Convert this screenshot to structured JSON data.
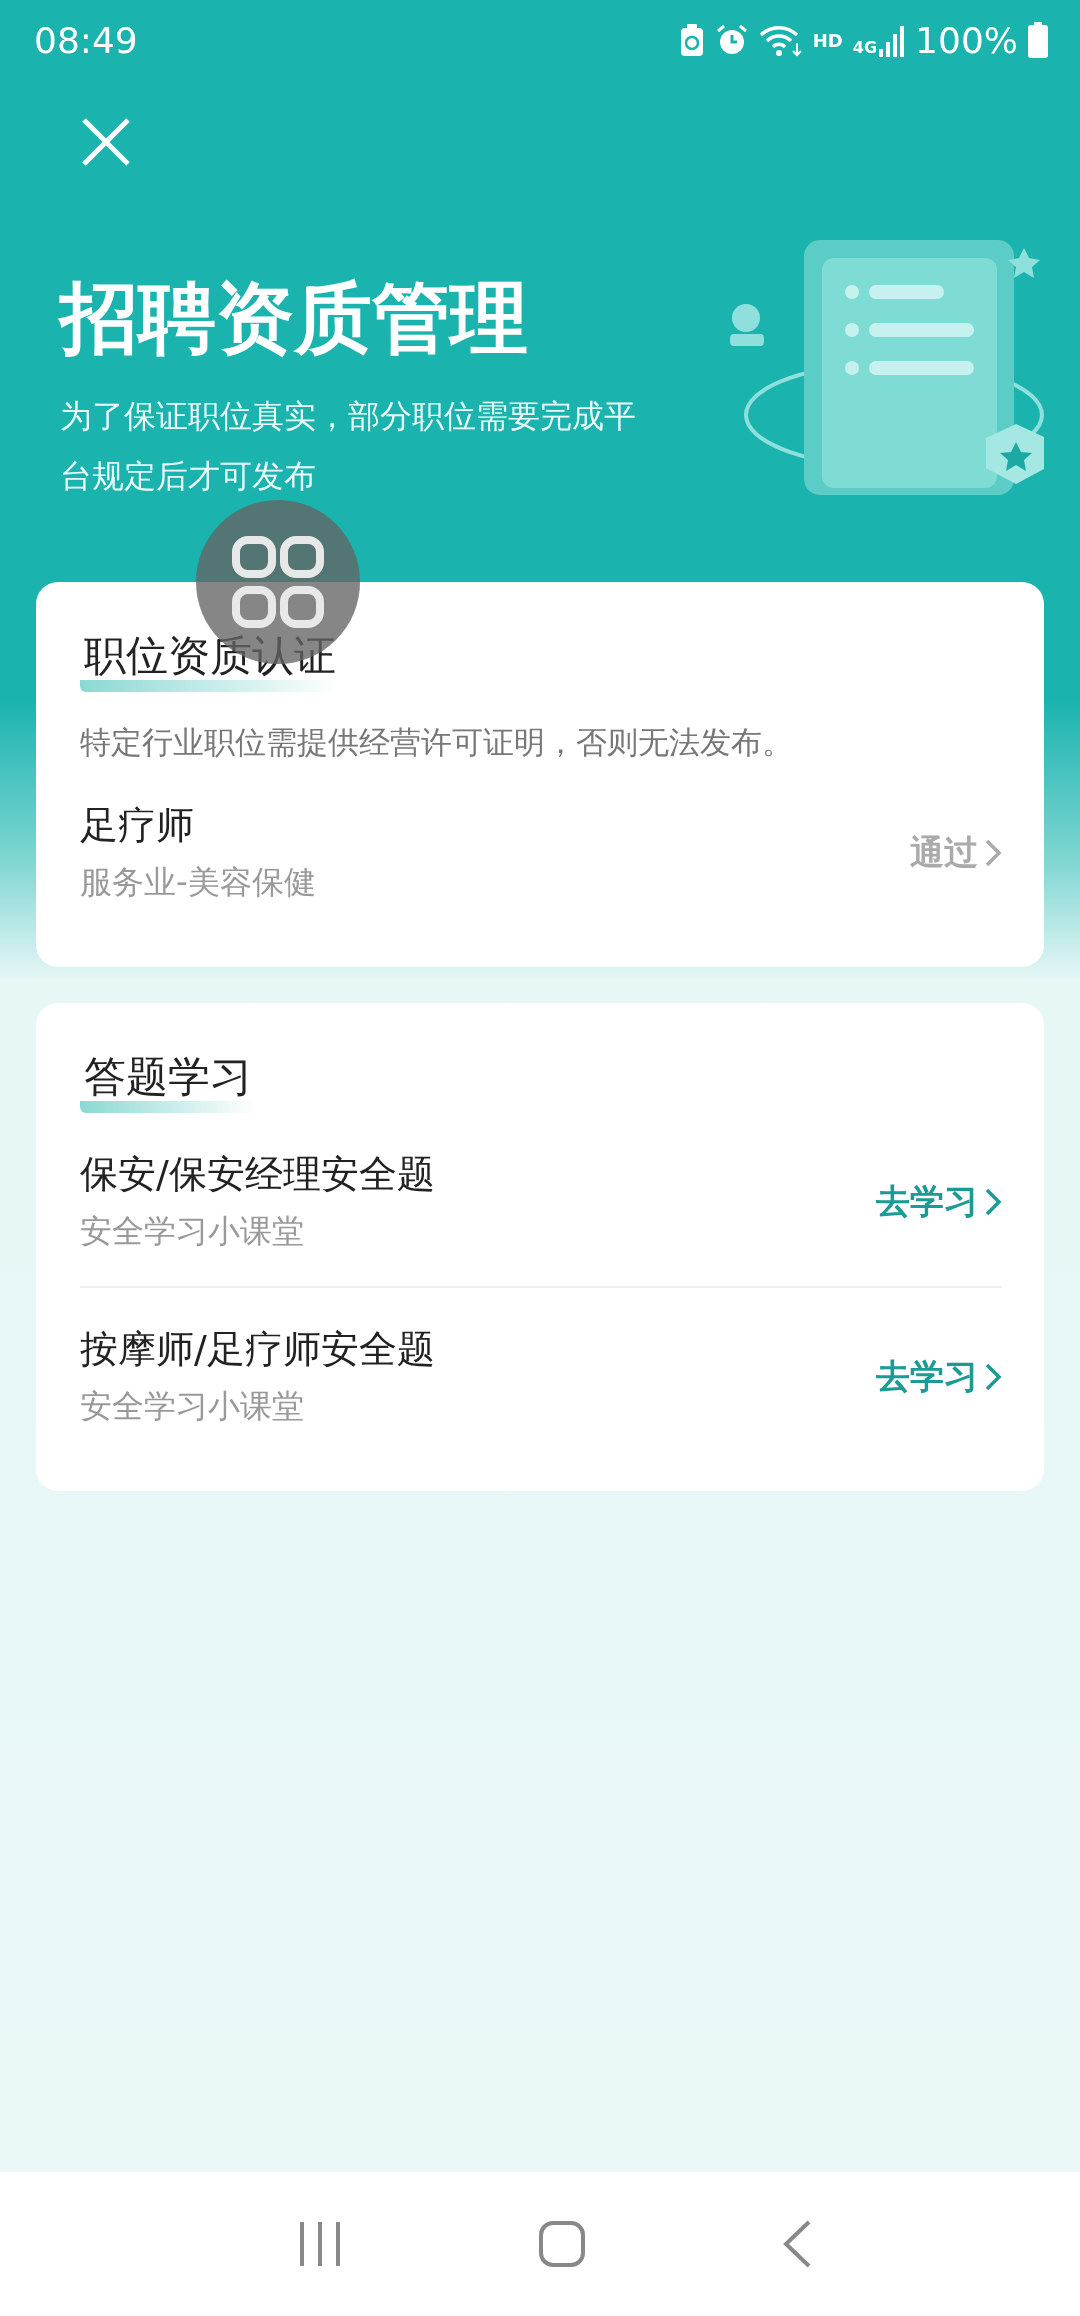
{
  "status_bar": {
    "time": "08:49",
    "network": "HD",
    "cell": "4G",
    "battery": "100%"
  },
  "header": {
    "title": "招聘资质管理",
    "subtitle": "为了保证职位真实，部分职位需要完成平台规定后才可发布"
  },
  "sections": [
    {
      "title": "职位资质认证",
      "note": "特定行业职位需提供经营许可证明，否则无法发布。",
      "items": [
        {
          "title": "足疗师",
          "subtitle": "服务业-美容保健",
          "action": "通过",
          "passed": true
        }
      ]
    },
    {
      "title": "答题学习",
      "items": [
        {
          "title": "保安/保安经理安全题",
          "subtitle": "安全学习小课堂",
          "action": "去学习",
          "passed": false
        },
        {
          "title": "按摩师/足疗师安全题",
          "subtitle": "安全学习小课堂",
          "action": "去学习",
          "passed": false
        }
      ]
    }
  ]
}
